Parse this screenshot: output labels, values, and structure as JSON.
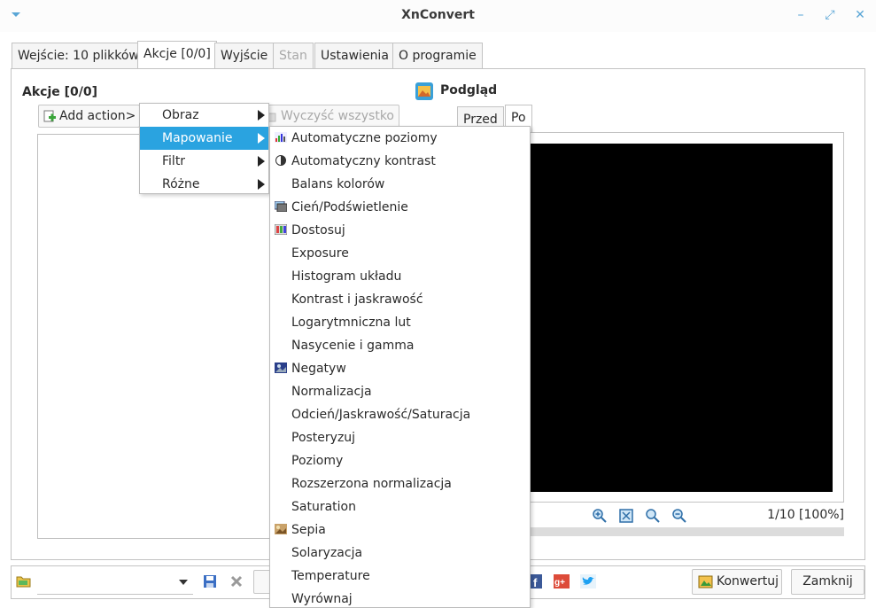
{
  "window": {
    "title": "XnConvert"
  },
  "tabs": [
    {
      "label": "Wejście: 10 plikków"
    },
    {
      "label": "Akcje [0/0]"
    },
    {
      "label": "Wyjście"
    },
    {
      "label": "Stan"
    },
    {
      "label": "Ustawienia"
    },
    {
      "label": "O programie"
    }
  ],
  "actions": {
    "heading": "Akcje [0/0]",
    "add_action_label": "Add action>",
    "clear_all_label": "Wyczyść wszystko"
  },
  "preview": {
    "heading": "Podgląd",
    "tab_before": "Przed",
    "tab_after": "Po",
    "page_info": "1/10 [100%]"
  },
  "menu_main": [
    {
      "label": "Obraz"
    },
    {
      "label": "Mapowanie"
    },
    {
      "label": "Filtr"
    },
    {
      "label": "Różne"
    }
  ],
  "menu_mapping": [
    {
      "label": "Automatyczne poziomy",
      "icon": "auto-levels-icon"
    },
    {
      "label": "Automatyczny kontrast",
      "icon": "auto-contrast-icon"
    },
    {
      "label": "Balans kolorów",
      "icon": ""
    },
    {
      "label": "Cień/Podświetlenie",
      "icon": "shadow-highlight-icon"
    },
    {
      "label": "Dostosuj",
      "icon": "adjust-icon"
    },
    {
      "label": "Exposure",
      "icon": ""
    },
    {
      "label": "Histogram układu",
      "icon": ""
    },
    {
      "label": "Kontrast i jaskrawość",
      "icon": ""
    },
    {
      "label": "Logarytmniczna lut",
      "icon": ""
    },
    {
      "label": "Nasycenie i gamma",
      "icon": ""
    },
    {
      "label": "Negatyw",
      "icon": "negative-icon"
    },
    {
      "label": "Normalizacja",
      "icon": ""
    },
    {
      "label": "Odcień/Jaskrawość/Saturacja",
      "icon": ""
    },
    {
      "label": "Posteryzuj",
      "icon": ""
    },
    {
      "label": "Poziomy",
      "icon": ""
    },
    {
      "label": "Rozszerzona normalizacja",
      "icon": ""
    },
    {
      "label": "Saturation",
      "icon": ""
    },
    {
      "label": "Sepia",
      "icon": "sepia-icon"
    },
    {
      "label": "Solaryzacja",
      "icon": ""
    },
    {
      "label": "Temperature",
      "icon": ""
    },
    {
      "label": "Wyrównaj",
      "icon": ""
    }
  ],
  "bottom": {
    "convert_label": "Konwertuj",
    "close_label": "Zamknij"
  },
  "colors": {
    "accent": "#2aa3e0",
    "preview_bg": "#000000"
  }
}
